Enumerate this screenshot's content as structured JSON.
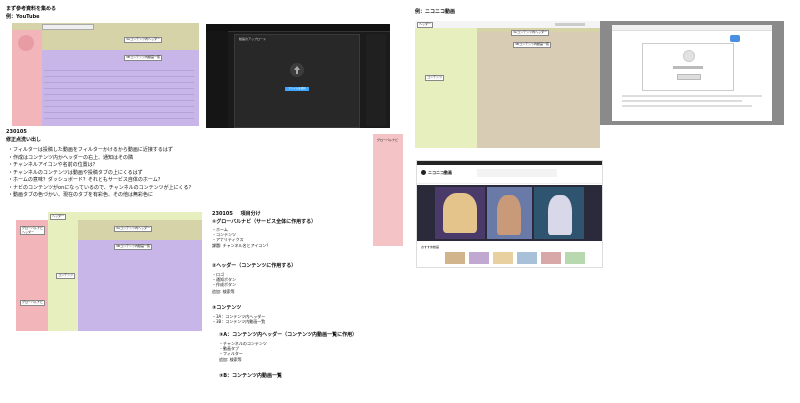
{
  "header": {
    "title": "まず参考資料を集める",
    "example_youtube": "例：YouTube",
    "example_niconico": "例：ニコニコ動画"
  },
  "youtube_mock": {
    "labels": {
      "global_nav": "グローバルナビ",
      "content_header": "3Aコンテンツ内ヘッダー",
      "video_list": "3Bコンテンツ内動画一覧",
      "content": "コンテンツ"
    },
    "rows": 10
  },
  "dark_upload": {
    "dialog_title": "動画のアップロード",
    "button": "ファイルを選択"
  },
  "notes": {
    "date": "230105",
    "heading": "修正点洗い出し",
    "items": [
      "フィルターは投稿した動画をフィルターかけるから動画に近接するはず",
      "作成はコンテンツ内かヘッダーの右上、通知はその隣",
      "チャンネルアイコンや名前の位置は？",
      "チャンネルのコンテンツは動画や投稿タブの上にくるはず",
      "ホームの意味？ダッシュボード？それともサービス自体のホーム？",
      "ナビのコンテンツがonになっているので、チャンネルのコンテンツが上にくる？",
      "動画タブの色づかい、現在のタブを有彩色、その他は無彩色に"
    ]
  },
  "pink_box_label": "グローバルナビ",
  "wireframe": {
    "header_label": "ヘッダー",
    "global_nav_label": "グローバルナビ\nヘッダー",
    "global_nav_label2": "グローバルナビ",
    "content_label": "コンテンツ",
    "content_header_label": "3Aコンテンツ内ヘッダー",
    "video_list_label": "3Bコンテンツ内動画一覧"
  },
  "classification": {
    "date": "230105",
    "title": "項目分け",
    "section1": {
      "title": "①グローバルナビ（サービス全体に作用する）",
      "items": [
        "・ホーム",
        "・コンテンツ",
        "・アナリティクス"
      ],
      "note": "課題: チャンネル名とアイコン？"
    },
    "section2": {
      "title": "②ヘッダー（コンテンツに作用する）",
      "items": [
        "・ロゴ",
        "・通知ボタン",
        "・作成ボタン"
      ],
      "note": "追加: 検索等"
    },
    "section3": {
      "title": "③コンテンツ",
      "items": [
        "・3A：コンテンツ内ヘッダー",
        "・3B：コンテンツ内動画一覧"
      ]
    },
    "section3a": {
      "title": "③A：コンテンツ内ヘッダー（コンテンツ内動画一覧に作用）",
      "items": [
        "・チャンネルのコンテンツ",
        "・動画タブ",
        "・フィルター"
      ],
      "note": "追加: 検索等"
    },
    "section3b": {
      "title": "③B：コンテンツ内動画一覧"
    }
  },
  "nico_mock": {
    "header_label": "ヘッダー",
    "content_header": "3Aコンテンツ内ヘッダー",
    "video_list": "3Bコンテンツ内動画一覧",
    "content": "コンテンツ"
  },
  "nico_site": {
    "logo": "ニコニコ動画",
    "section": "おすすめ動画"
  },
  "colors": {
    "nav_pink": "#f2b5b9",
    "content_green": "#e6efbd",
    "header_khaki": "#d6d3a8",
    "list_purple": "#c9b6e8",
    "nico_beige": "#d8ccb4"
  }
}
